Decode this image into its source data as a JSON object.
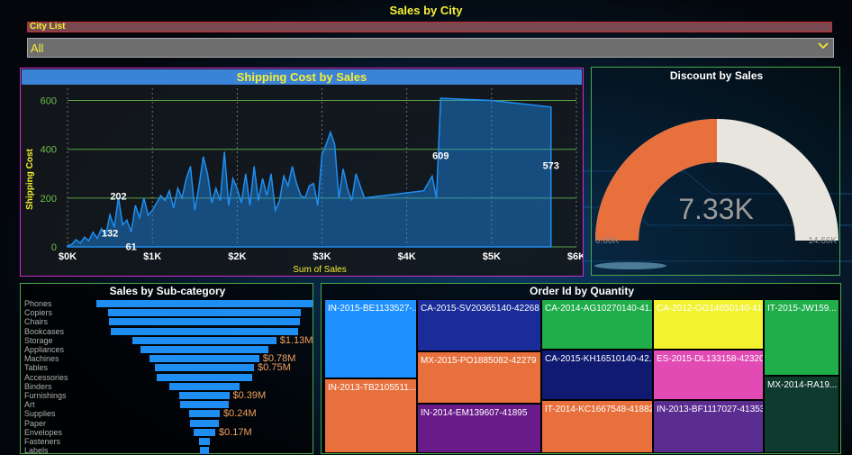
{
  "header": {
    "title": "Sales by City"
  },
  "city_filter": {
    "label": "City List",
    "selected": "All"
  },
  "shipping": {
    "title": "Shipping Cost by Sales",
    "xlabel": "Sum of Sales",
    "ylabel": "Shipping Cost",
    "x_ticks": [
      "$0K",
      "$1K",
      "$2K",
      "$3K",
      "$4K",
      "$5K",
      "$6K"
    ],
    "y_ticks": [
      "0",
      "200",
      "400",
      "600"
    ],
    "data_labels": [
      "132",
      "202",
      "61",
      "609",
      "573"
    ]
  },
  "chart_data": [
    {
      "type": "area",
      "title": "Shipping Cost by Sales",
      "xlabel": "Sum of Sales",
      "ylabel": "Shipping Cost",
      "xlim": [
        0,
        6000
      ],
      "ylim": [
        0,
        650
      ],
      "grid": true,
      "x": [
        0,
        50,
        100,
        150,
        200,
        250,
        300,
        350,
        400,
        450,
        500,
        550,
        600,
        650,
        700,
        750,
        800,
        850,
        900,
        950,
        1000,
        1050,
        1100,
        1150,
        1200,
        1250,
        1300,
        1350,
        1400,
        1450,
        1500,
        1550,
        1600,
        1650,
        1700,
        1750,
        1800,
        1850,
        1900,
        1950,
        2000,
        2050,
        2100,
        2150,
        2200,
        2250,
        2300,
        2350,
        2400,
        2450,
        2500,
        2550,
        2600,
        2650,
        2700,
        2750,
        2800,
        2850,
        2900,
        2950,
        3000,
        3050,
        3100,
        3150,
        3200,
        3250,
        3300,
        3350,
        3400,
        3500,
        4200,
        4250,
        4300,
        4350,
        4400,
        5000,
        5700
      ],
      "y": [
        5,
        10,
        30,
        15,
        40,
        25,
        60,
        35,
        75,
        50,
        132,
        80,
        202,
        90,
        110,
        61,
        170,
        120,
        200,
        130,
        150,
        180,
        210,
        190,
        230,
        160,
        240,
        200,
        280,
        330,
        150,
        250,
        370,
        300,
        180,
        240,
        190,
        390,
        170,
        280,
        240,
        180,
        300,
        170,
        330,
        190,
        280,
        210,
        300,
        150,
        190,
        290,
        250,
        330,
        260,
        210,
        200,
        250,
        260,
        170,
        380,
        420,
        470,
        420,
        200,
        320,
        240,
        190,
        300,
        200,
        230,
        260,
        290,
        200,
        609,
        600,
        573
      ],
      "annotations": [
        "132",
        "202",
        "61",
        "609",
        "573"
      ]
    },
    {
      "type": "gauge",
      "title": "Discount by Sales",
      "value": 7330,
      "min": 0,
      "max": 14660,
      "value_label": "7.33K",
      "min_label": "0.00K",
      "max_label": "14.66K"
    },
    {
      "type": "bar",
      "title": "Sales by Sub-category",
      "categories": [
        "Phones",
        "Copiers",
        "Chairs",
        "Bookcases",
        "Storage",
        "Appliances",
        "Machines",
        "Tables",
        "Accessories",
        "Binders",
        "Furnishings",
        "Art",
        "Supplies",
        "Paper",
        "Envelopes",
        "Fasteners",
        "Labels"
      ],
      "values": [
        1.7,
        1.52,
        1.5,
        1.47,
        1.13,
        1.0,
        0.86,
        0.78,
        0.75,
        0.55,
        0.39,
        0.38,
        0.24,
        0.23,
        0.17,
        0.08,
        0.07
      ],
      "value_labels": {
        "Storage": "$1.13M",
        "Machines": "$0.78M",
        "Tables": "$0.75M",
        "Furnishings": "$0.39M",
        "Supplies": "$0.24M",
        "Envelopes": "$0.17M"
      }
    }
  ],
  "gauge_colors": {
    "fill": "#e8703c",
    "track": "#e8e4de",
    "value_text": "#9a9a9a"
  },
  "subcat": {
    "title": "Sales by Sub-category"
  },
  "orders": {
    "title": "Order Id by Quantity",
    "tiles": [
      {
        "id": "IN-2015-BE1133527-...",
        "color": "#1e90ff"
      },
      {
        "id": "IN-2013-TB2105511...",
        "color": "#e8703c"
      },
      {
        "id": "CA-2015-SV20365140-42268",
        "color": "#1a2c9a"
      },
      {
        "id": "MX-2015-PO1885082-42279",
        "color": "#e8703c"
      },
      {
        "id": "IN-2014-EM139607-41895",
        "color": "#6a1b8a"
      },
      {
        "id": "CA-2014-AG10270140-41...",
        "color": "#1fae4a"
      },
      {
        "id": "CA-2015-KH16510140-42...",
        "color": "#101a70"
      },
      {
        "id": "IT-2014-KC1667548-41882",
        "color": "#e8703c"
      },
      {
        "id": "CA-2012-GG14650140-41...",
        "color": "#f2f230"
      },
      {
        "id": "ES-2015-DL133158-42320",
        "color": "#e24ab4"
      },
      {
        "id": "IN-2013-BF1117027-41353",
        "color": "#5b2d91"
      },
      {
        "id": "IT-2015-JW159...",
        "color": "#1fae4a"
      },
      {
        "id": "MX-2014-RA19...",
        "color": "#0f3a2e"
      }
    ]
  }
}
